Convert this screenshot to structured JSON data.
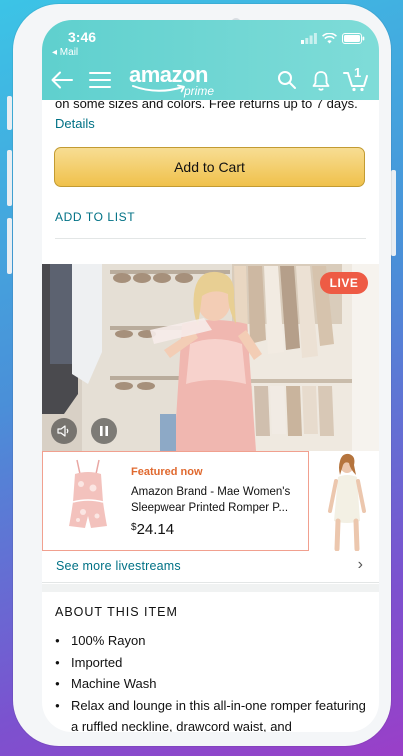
{
  "status_bar": {
    "time": "3:46",
    "back_app": "◂ Mail"
  },
  "nav": {
    "logo_word": "amazon",
    "logo_prime": "prime",
    "cart_count": "1"
  },
  "product": {
    "shipping_text": "on some sizes and colors. Free returns up to 7 days.",
    "details_link": "Details",
    "add_to_cart": "Add to Cart",
    "add_to_list": "ADD TO LIST"
  },
  "livestream": {
    "live_badge": "LIVE",
    "featured_label": "Featured now",
    "featured_title": "Amazon Brand - Mae Women's Sleepwear Printed Romper P...",
    "price_symbol": "$",
    "price_value": "24.14",
    "see_more": "See more livestreams"
  },
  "about": {
    "title": "ABOUT THIS ITEM",
    "bullets": [
      "100% Rayon",
      "Imported",
      "Machine Wash",
      "Relax and lounge in this all-in-one romper featuring a ruffled neckline, drawcord waist, and"
    ]
  },
  "colors": {
    "header": "#6dd5d2",
    "cart_button": "#f0c14b",
    "link": "#007185",
    "live": "#ee5b45",
    "featured_label": "#e0692f"
  }
}
